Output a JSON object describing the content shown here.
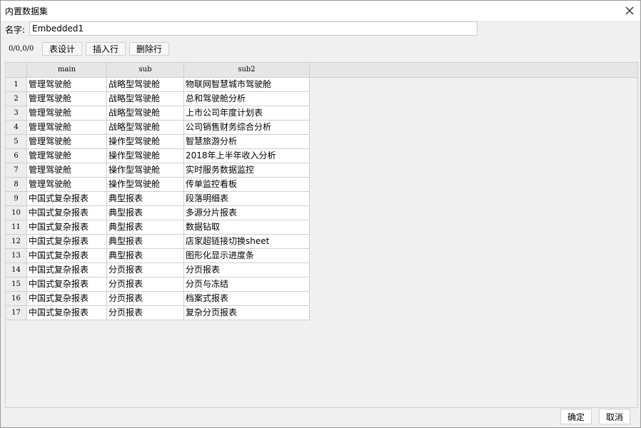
{
  "window": {
    "title": "内置数据集"
  },
  "name_field": {
    "label": "名字:",
    "value": "Embedded1"
  },
  "toolbar": {
    "counter": "0/0,0/0",
    "design_label": "表设计",
    "insert_label": "插入行",
    "delete_label": "删除行"
  },
  "table": {
    "columns": [
      "main",
      "sub",
      "sub2"
    ],
    "rows": [
      [
        "1",
        "管理驾驶舱",
        "战略型驾驶舱",
        "物联网智慧城市驾驶舱"
      ],
      [
        "2",
        "管理驾驶舱",
        "战略型驾驶舱",
        "总和驾驶舱分析"
      ],
      [
        "3",
        "管理驾驶舱",
        "战略型驾驶舱",
        "上市公司年度计划表"
      ],
      [
        "4",
        "管理驾驶舱",
        "战略型驾驶舱",
        "公司销售财务综合分析"
      ],
      [
        "5",
        "管理驾驶舱",
        "操作型驾驶舱",
        "智慧旅游分析"
      ],
      [
        "6",
        "管理驾驶舱",
        "操作型驾驶舱",
        "2018年上半年收入分析"
      ],
      [
        "7",
        "管理驾驶舱",
        "操作型驾驶舱",
        "实时服务数据监控"
      ],
      [
        "8",
        "管理驾驶舱",
        "操作型驾驶舱",
        "传单监控看板"
      ],
      [
        "9",
        "中国式复杂报表",
        "典型报表",
        "段落明细表"
      ],
      [
        "10",
        "中国式复杂报表",
        "典型报表",
        "多源分片报表"
      ],
      [
        "11",
        "中国式复杂报表",
        "典型报表",
        "数据钻取"
      ],
      [
        "12",
        "中国式复杂报表",
        "典型报表",
        "店家超链接切换sheet"
      ],
      [
        "13",
        "中国式复杂报表",
        "典型报表",
        "图形化显示进度条"
      ],
      [
        "14",
        "中国式复杂报表",
        "分页报表",
        "分页报表"
      ],
      [
        "15",
        "中国式复杂报表",
        "分页报表",
        "分页与冻结"
      ],
      [
        "16",
        "中国式复杂报表",
        "分页报表",
        "档案式报表"
      ],
      [
        "17",
        "中国式复杂报表",
        "分页报表",
        "复杂分页报表"
      ]
    ]
  },
  "footer": {
    "ok_label": "确定",
    "cancel_label": "取消"
  }
}
